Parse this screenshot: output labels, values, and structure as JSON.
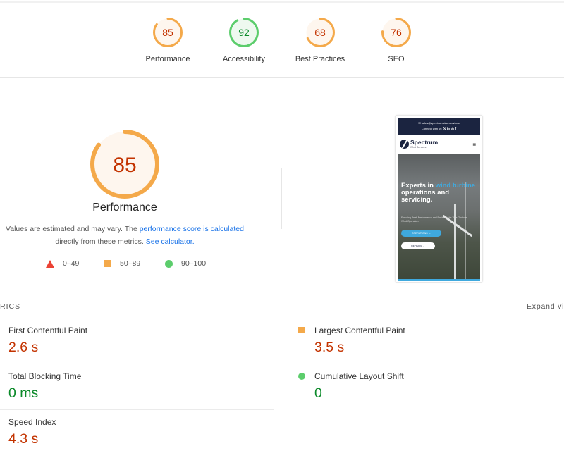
{
  "summary_gauges": [
    {
      "label": "Performance",
      "score": 85,
      "rating": "average"
    },
    {
      "label": "Accessibility",
      "score": 92,
      "rating": "pass"
    },
    {
      "label": "Best Practices",
      "score": 68,
      "rating": "average"
    },
    {
      "label": "SEO",
      "score": 76,
      "rating": "average"
    }
  ],
  "colors": {
    "average_stroke": "#f4a94a",
    "average_fill": "#fef6ee",
    "average_text": "#c33300",
    "pass_stroke": "#5ccd6c",
    "pass_fill": "#eef9ef",
    "pass_text": "#0c8a2a",
    "fail": "#eb4234",
    "link": "#1a73e8"
  },
  "performance": {
    "score": 85,
    "title": "Performance",
    "desc_prefix": "Values are estimated and may vary. The ",
    "desc_link1": "performance score is calculated",
    "desc_middle": " directly from these metrics. ",
    "desc_link2": "See calculator."
  },
  "legend": [
    {
      "icon": "red-triangle-icon",
      "range": "0–49"
    },
    {
      "icon": "orange-square-icon",
      "range": "50–89"
    },
    {
      "icon": "green-circle-icon",
      "range": "90–100"
    }
  ],
  "screenshot": {
    "email": "✉ sales@spectrumwind.services",
    "connect": "Connect with us:",
    "social": "𝕏 in ◎ f",
    "brand": "Spectrum",
    "brand_sub": "Wind Services",
    "menu": "≡",
    "headline_1": "Experts in ",
    "headline_accent": "wind turbine",
    "headline_2": " operations and servicing.",
    "tagline": "Ensuring Peak Performance and Reliability for Your Onshore Wind Operations",
    "btn_operations": "OPERATIONS →",
    "btn_repairs": "REPAIRS →"
  },
  "metrics": {
    "header": "RICS",
    "expand_label": "Expand vi",
    "left": [
      {
        "name": "First Contentful Paint",
        "value": "2.6 s",
        "rating": "average"
      },
      {
        "name": "Total Blocking Time",
        "value": "0 ms",
        "rating": "pass"
      },
      {
        "name": "Speed Index",
        "value": "4.3 s",
        "rating": "average"
      }
    ],
    "right": [
      {
        "name": "Largest Contentful Paint",
        "value": "3.5 s",
        "rating": "average",
        "icon": "orange-square-icon"
      },
      {
        "name": "Cumulative Layout Shift",
        "value": "0",
        "rating": "pass",
        "icon": "green-circle-icon"
      }
    ]
  }
}
